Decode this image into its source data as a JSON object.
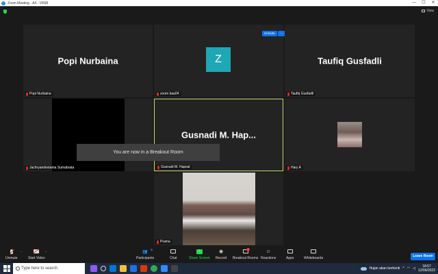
{
  "window": {
    "title": "Zoom Meeting - A4 - VR68",
    "controls": [
      "—",
      "☐",
      "✕"
    ]
  },
  "view_label": "View",
  "tiles": {
    "popi": {
      "big": "Popi Nurbaina",
      "name": "Popi Nurbaina"
    },
    "zoom": {
      "avatar": "Z",
      "name": "zoom baa04",
      "unmute": "Unmute",
      "more": "···"
    },
    "taufiq": {
      "big": "Taufiq Gusfadli",
      "name": "Taufiq Gusfadli"
    },
    "jachry": {
      "name": "Jachryandestama Sumabrata"
    },
    "gusnadi": {
      "big": "Gusnadi M. Hap...",
      "name": "Gusnadi M. Hapsal"
    },
    "hary": {
      "name": "Hary A"
    },
    "prama": {
      "name": "Prama"
    }
  },
  "notice": "You are now in a Breakout Room",
  "toolbar": {
    "unmute": "Unmute",
    "start_video": "Start Video",
    "participants": "Participants",
    "participants_count": "9",
    "chat": "Chat",
    "share_screen": "Share Screen",
    "record": "Record",
    "breakout_rooms": "Breakout Rooms",
    "breakout_badge": "1",
    "reactions": "Reactions",
    "apps": "Apps",
    "whiteboards": "Whiteboards",
    "leave": "Leave Room"
  },
  "taskbar": {
    "search_placeholder": "Type here to search",
    "weather": "Hujan akan berhenti",
    "time": "18:57",
    "date": "12/06/2022"
  },
  "colors": {
    "accent": "#0e72ed",
    "active_speaker": "#c8e06c",
    "share_green": "#23d959",
    "mic_muted": "#e02828"
  }
}
